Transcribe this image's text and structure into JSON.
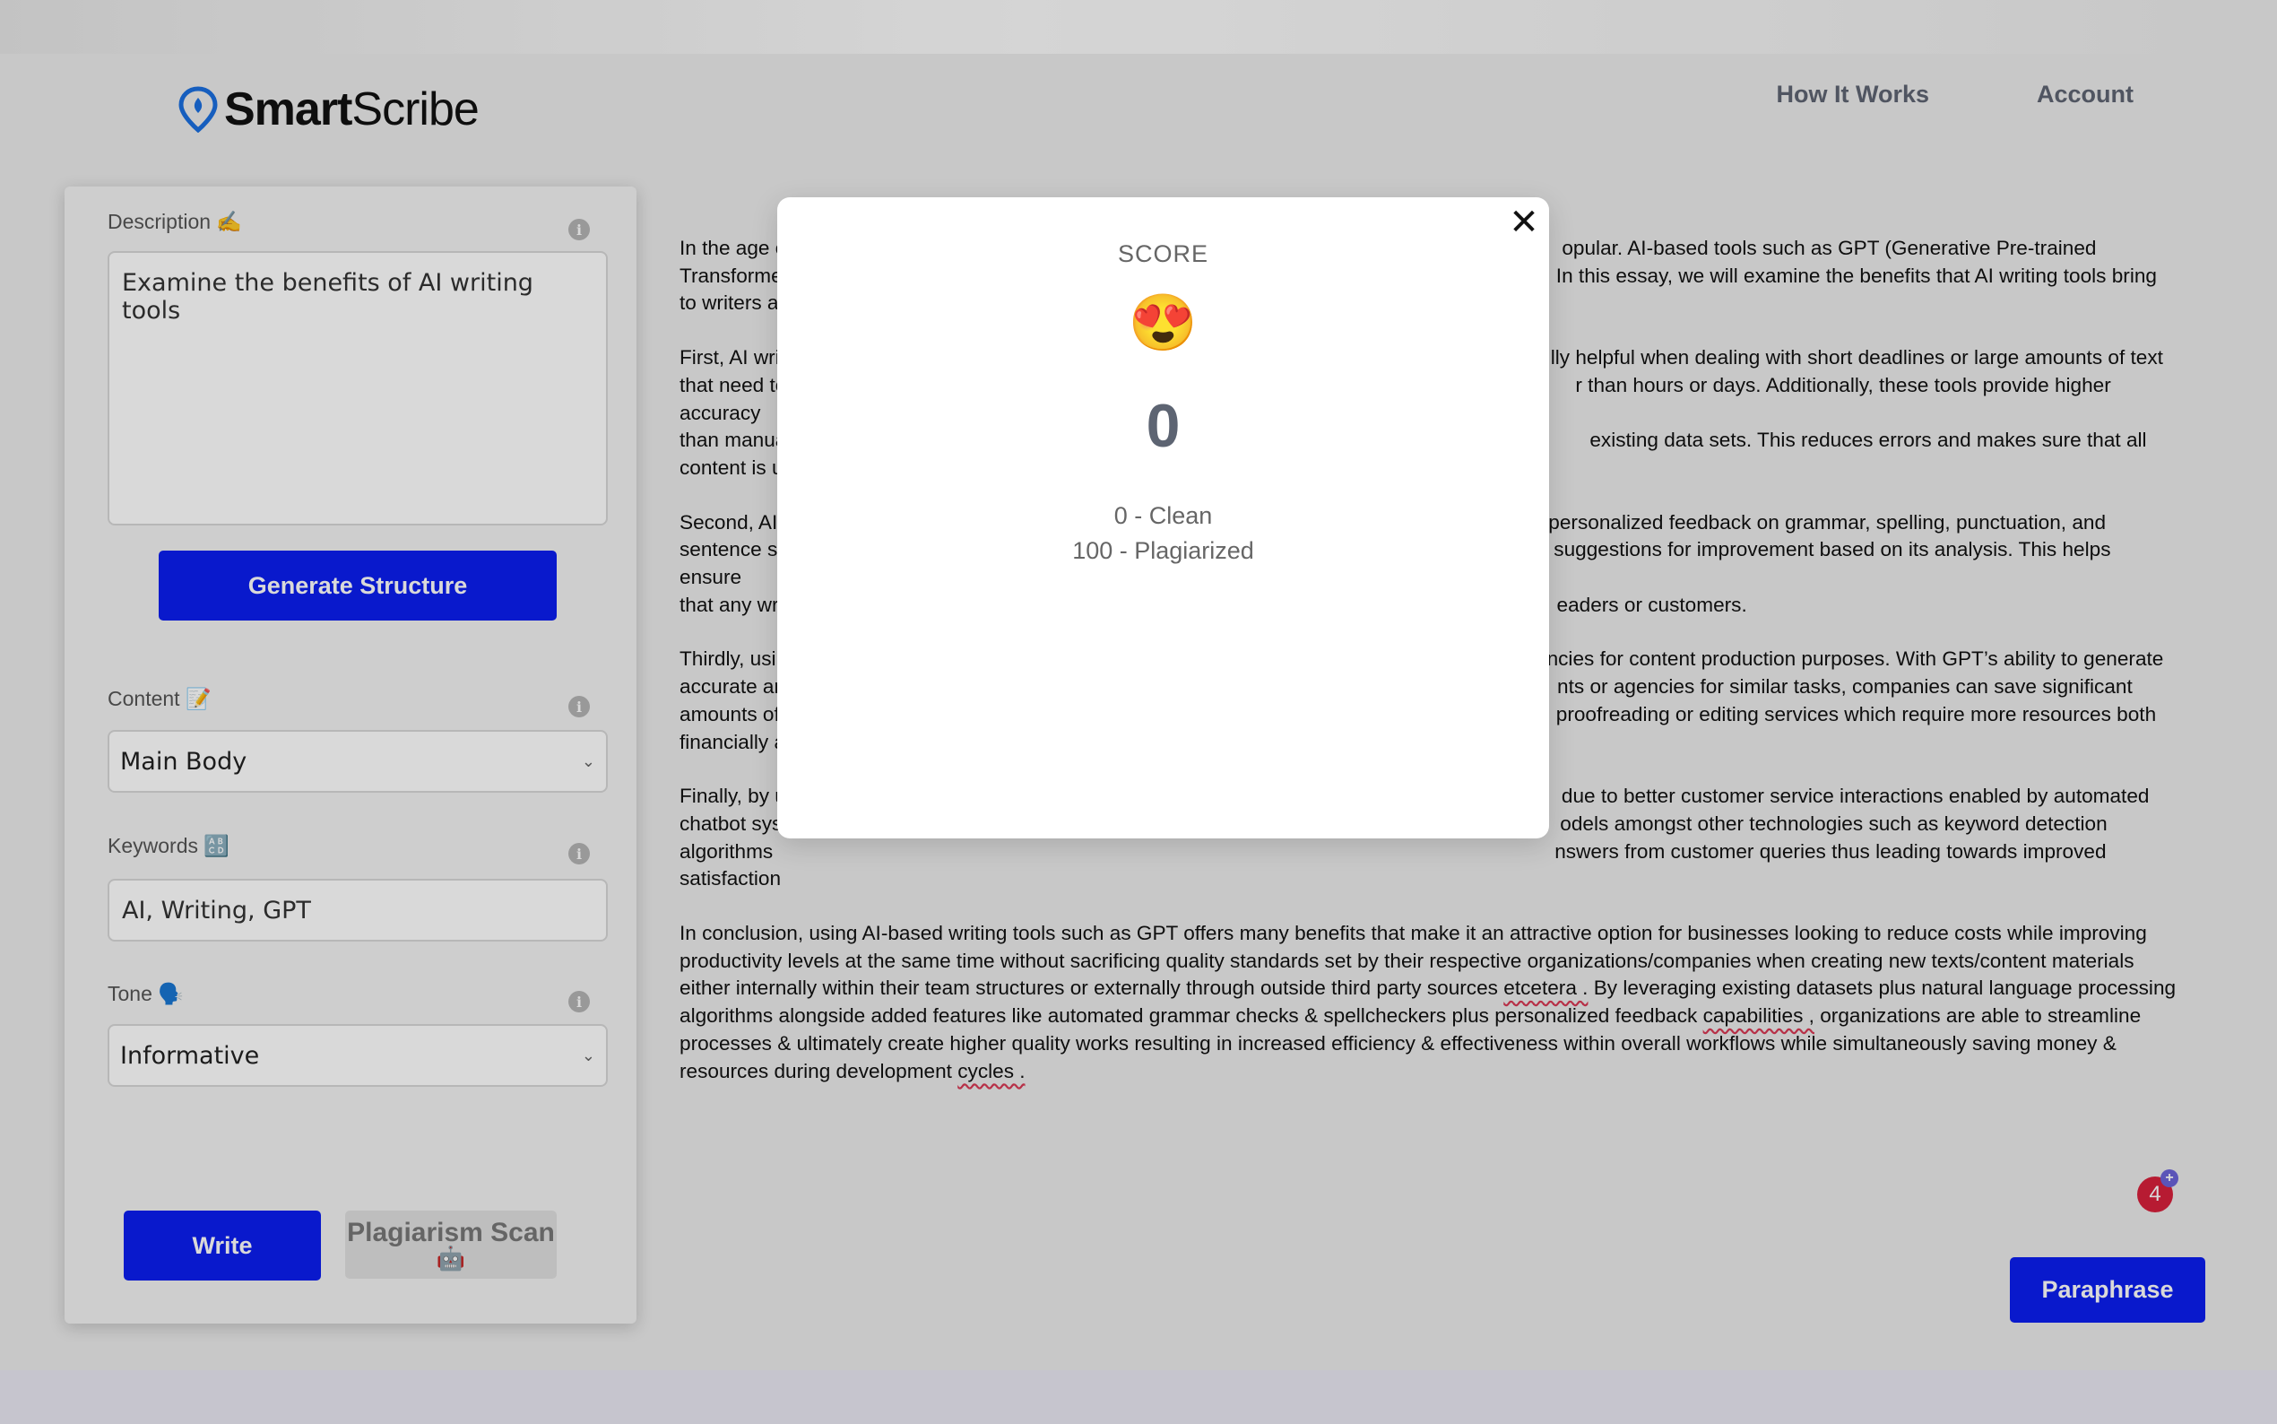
{
  "header": {
    "logo_bold": "Smart",
    "logo_regular": "Scribe",
    "nav": [
      {
        "label": "How It Works"
      },
      {
        "label": "Account"
      }
    ]
  },
  "sidebar": {
    "description_label": "Description ✍️",
    "description_value": "Examine the benefits of AI writing tools",
    "generate_button": "Generate Structure",
    "content_label": "Content 📝",
    "content_value": "Main Body",
    "keywords_label": "Keywords 🔠",
    "keywords_value": "AI, Writing, GPT",
    "tone_label": "Tone 🗣️",
    "tone_value": "Informative",
    "write_button": "Write",
    "plagiarism_button": "Plagiarism Scan",
    "plagiarism_emoji": "🤖",
    "info_glyph": "i"
  },
  "article": {
    "p1a": "In the age o",
    "p1b": "opular. AI-based tools such as GPT (Generative Pre-trained",
    "p1c": "Transforme",
    "p1d": "e. In this essay, we will examine the benefits that AI writing tools bring",
    "p1e": "to writers a",
    "p2a": "First, AI wri",
    "p2b": "lly helpful when dealing with short deadlines or large amounts of text",
    "p2c": "that need to",
    "p2d": "r than hours or days. Additionally, these tools provide higher accuracy",
    "p2e": "than manua",
    "p2f": "existing data sets. This reduces errors and makes sure that all",
    "p2g": "content is u",
    "p3a": "Second, AI",
    "p3b": "personalized feedback on grammar, spelling, punctuation, and",
    "p3c": "sentence s",
    "p3d": "suggestions for improvement based on its analysis. This helps ensure",
    "p3e": "that any wr",
    "p3f": "eaders or customers.",
    "p4a": "Thirdly, usi",
    "p4b": "ncies for content production purposes. With GPT’s ability to generate",
    "p4c": "accurate ar",
    "p4d": "nts or agencies for similar tasks, companies can save significant",
    "p4e": "amounts of",
    "p4f": "proofreading or editing services which require more resources both",
    "p4g": "financially a",
    "p5a": "Finally, by u",
    "p5b": "due to better customer service interactions enabled by automated",
    "p5c": "chatbot sys",
    "p5d": "odels amongst other technologies such as keyword detection",
    "p5e": "algorithms",
    "p5f": "nswers from customer queries thus leading towards improved",
    "p5g": "satisfaction",
    "p6_1": "In conclusion, using AI-based writing tools such as GPT offers many benefits that make it an attractive option for businesses looking to reduce costs while improving productivity levels at the same time without sacrificing quality standards set by their respective organizations/companies when creating new texts/content materials either internally within their team structures or externally through outside third party sources ",
    "p6_err1": "etcetera .",
    "p6_2": " By leveraging existing datasets plus natural language processing algorithms alongside added features like automated grammar checks & spellcheckers plus personalized feedback ",
    "p6_err2": "capabilities ,",
    "p6_3": " organizations are able to streamline processes & ultimately create higher quality works resulting in increased efficiency & effectiveness within overall workflows while simultaneously saving money & resources during development ",
    "p6_err3": "cycles ."
  },
  "badge": {
    "count": "4",
    "plus": "+"
  },
  "paraphrase_button": "Paraphrase",
  "modal": {
    "close_glyph": "✕",
    "title": "SCORE",
    "emoji": "😍",
    "score": "0",
    "legend_clean": "0 - Clean",
    "legend_plagiarized": "100 - Plagiarized"
  },
  "colors": {
    "primary": "#0b1ef0",
    "badge": "#d8203b",
    "logo_accent": "#1b6fe0"
  }
}
